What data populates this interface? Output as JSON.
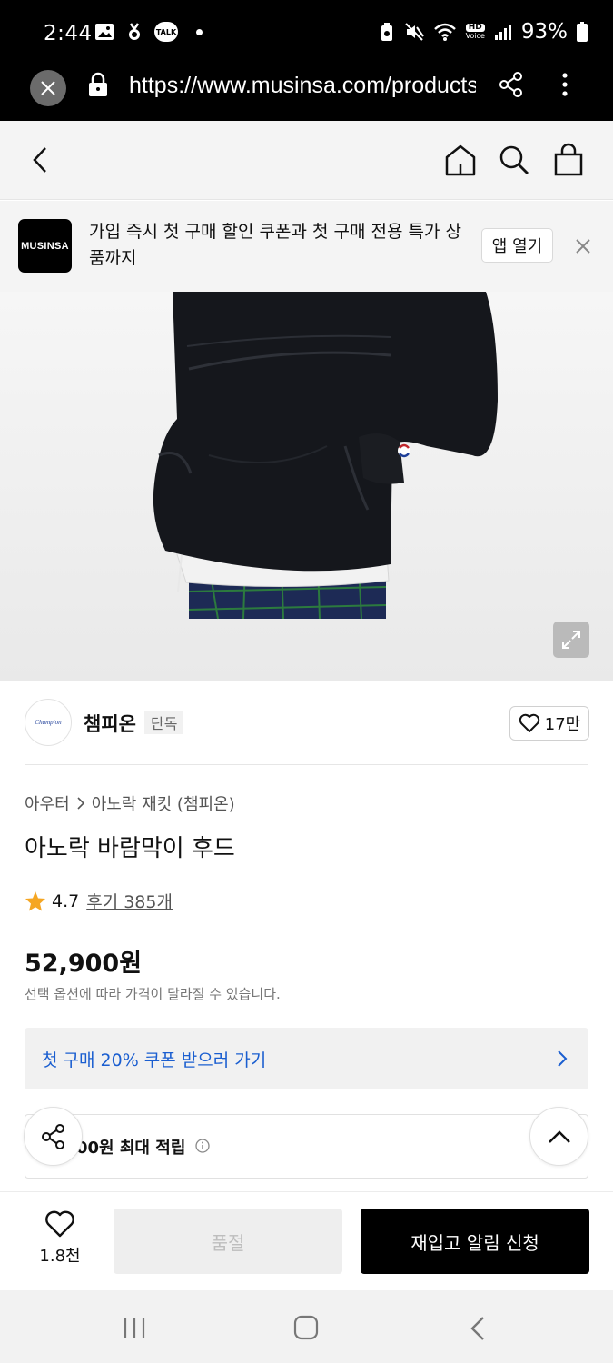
{
  "status_bar": {
    "time": "2:44",
    "battery": "93%",
    "hd_label": "HD",
    "voice_label": "Voice",
    "talk_label": "TALK"
  },
  "url_bar": {
    "url": "https://www.musinsa.com/products"
  },
  "banner": {
    "logo_text": "MUSINSA",
    "message": "가입 즉시 첫 구매 할인 쿠폰과 첫 구매 전용 특가 상품까지",
    "open_app_label": "앱 열기"
  },
  "brand": {
    "name": "챔피온",
    "tag": "단독",
    "likes": "17만",
    "logo_text": "Champion"
  },
  "product": {
    "breadcrumb": [
      "아우터",
      "아노락 재킷 (챔피온)"
    ],
    "title": "아노락 바람막이 후드",
    "rating": "4.7",
    "reviews_label": "후기 385개",
    "price": "52,900원",
    "price_note": "선택 옵션에 따라 가격이 달라질 수 있습니다."
  },
  "coupon": {
    "label": "첫 구매 20% 쿠폰 받으러 가기"
  },
  "points": {
    "label": "00원 최대 적립"
  },
  "bottom_bar": {
    "wish_count": "1.8천",
    "soldout_label": "품절",
    "restock_label": "재입고 알림 신청"
  },
  "colors": {
    "accent_blue": "#1a5ed0",
    "star": "#f5a623",
    "primary_black": "#000000"
  },
  "icons": {
    "back": "chevron-left-icon",
    "home": "home-icon",
    "search": "search-icon",
    "bag": "shopping-bag-icon",
    "share": "share-icon",
    "heart": "heart-icon",
    "expand": "expand-icon",
    "scroll_top": "chevron-up-icon"
  }
}
